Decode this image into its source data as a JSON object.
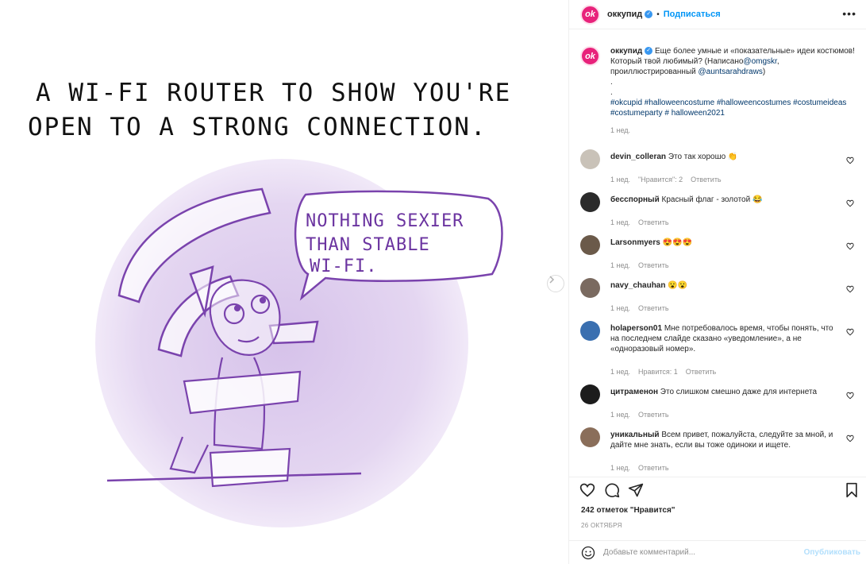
{
  "post": {
    "image_text": {
      "headline_line1": "A WI-FI ROUTER TO SHOW YOU'RE",
      "headline_line2": "OPEN TO A STRONG CONNECTION.",
      "bubble_line1": "NOTHING SEXIER",
      "bubble_line2": "THAN STABLE",
      "bubble_line3": "WI-FI."
    },
    "accent_color": "#9b63c4"
  },
  "header": {
    "avatar_text": "ok",
    "username": "оккупид",
    "separator": "•",
    "follow_label": "Подписаться",
    "more_label": "•••"
  },
  "caption": {
    "username": "оккупид",
    "text_a": "Еще более умные и «показательные» идеи костюмов! Который твой любимый? (Написано",
    "mention1": "@omgskr",
    "text_b": ", проиллюстрированный ",
    "mention2": "@auntsarahdraws",
    "text_c": ")",
    "dot1": ".",
    "dot2": ".",
    "hashtags": "#okcupid #halloweencostume #halloweencostumes #costumeideas #costumeparty # halloween2021",
    "time": "1 нед."
  },
  "comments": [
    {
      "user": "devin_colleran",
      "text": "Это так хорошо 👏",
      "time": "1 нед.",
      "likes": "\"Нравится\": 2",
      "reply": "Ответить",
      "avatar_color": "#c9c2b8"
    },
    {
      "user": "бесспорный",
      "text": "Красный флаг - золотой 😂",
      "time": "1 нед.",
      "likes": "",
      "reply": "Ответить",
      "avatar_color": "#2b2b2b"
    },
    {
      "user": "Larsonmyers",
      "text": "😍😍😍",
      "time": "1 нед.",
      "likes": "",
      "reply": "Ответить",
      "avatar_color": "#6b5a4a"
    },
    {
      "user": "navy_chauhan",
      "text": "😮😮",
      "time": "1 нед.",
      "likes": "",
      "reply": "Ответить",
      "avatar_color": "#7a6a60"
    },
    {
      "user": "holaperson01",
      "text": "Мне потребовалось время, чтобы понять, что на последнем слайде сказано «уведомление», а не «одноразовый номер».",
      "time": "1 нед.",
      "likes": "Нравится: 1",
      "reply": "Ответить",
      "avatar_color": "#3a6fb0"
    },
    {
      "user": "цитраменон",
      "text": "Это слишком смешно даже для интернета",
      "time": "1 нед.",
      "likes": "",
      "reply": "Ответить",
      "avatar_color": "#1c1c1c"
    },
    {
      "user": "уникальный",
      "text": "Всем привет, пожалуйста, следуйте за мной, и дайте мне знать, если вы тоже одиноки и ищете.",
      "time": "1 нед.",
      "likes": "",
      "reply": "Ответить",
      "avatar_color": "#8a6e5a"
    }
  ],
  "actions": {
    "likes_text": "242 отметок \"Нравится\"",
    "date": "26 ОКТЯБРЯ"
  },
  "add_comment": {
    "placeholder": "Добавьте комментарий...",
    "publish_label": "Опубликовать"
  },
  "icons": [
    "heart-icon",
    "comment-icon",
    "share-icon",
    "bookmark-icon",
    "emoji-icon",
    "verified-icon",
    "chevron-right-icon",
    "more-icon"
  ]
}
